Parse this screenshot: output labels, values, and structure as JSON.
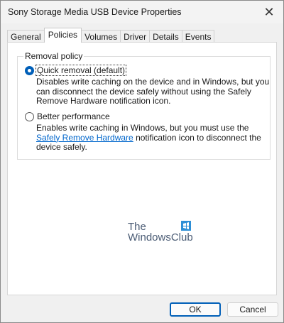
{
  "window": {
    "title": "Sony Storage Media USB Device Properties",
    "close_glyph": "✕"
  },
  "tabs": [
    {
      "label": "General",
      "active": false
    },
    {
      "label": "Policies",
      "active": true
    },
    {
      "label": "Volumes",
      "active": false
    },
    {
      "label": "Driver",
      "active": false
    },
    {
      "label": "Details",
      "active": false
    },
    {
      "label": "Events",
      "active": false
    }
  ],
  "removal_policy": {
    "group_label": "Removal policy",
    "options": [
      {
        "label": "Quick removal (default)",
        "checked": true,
        "description": "Disables write caching on the device and in Windows, but you can disconnect the device safely without using the Safely Remove Hardware notification icon."
      },
      {
        "label": "Better performance",
        "checked": false,
        "description_before": "Enables write caching in Windows, but you must use the ",
        "description_link": "Safely Remove Hardware",
        "description_after": " notification icon to disconnect the device safely."
      }
    ]
  },
  "watermark": {
    "line1": "The",
    "line2": "WindowsClub",
    "logo_color": "#2e8fd6"
  },
  "buttons": {
    "ok": "OK",
    "cancel": "Cancel"
  },
  "colors": {
    "accent": "#005fb8",
    "link": "#0066cc"
  }
}
